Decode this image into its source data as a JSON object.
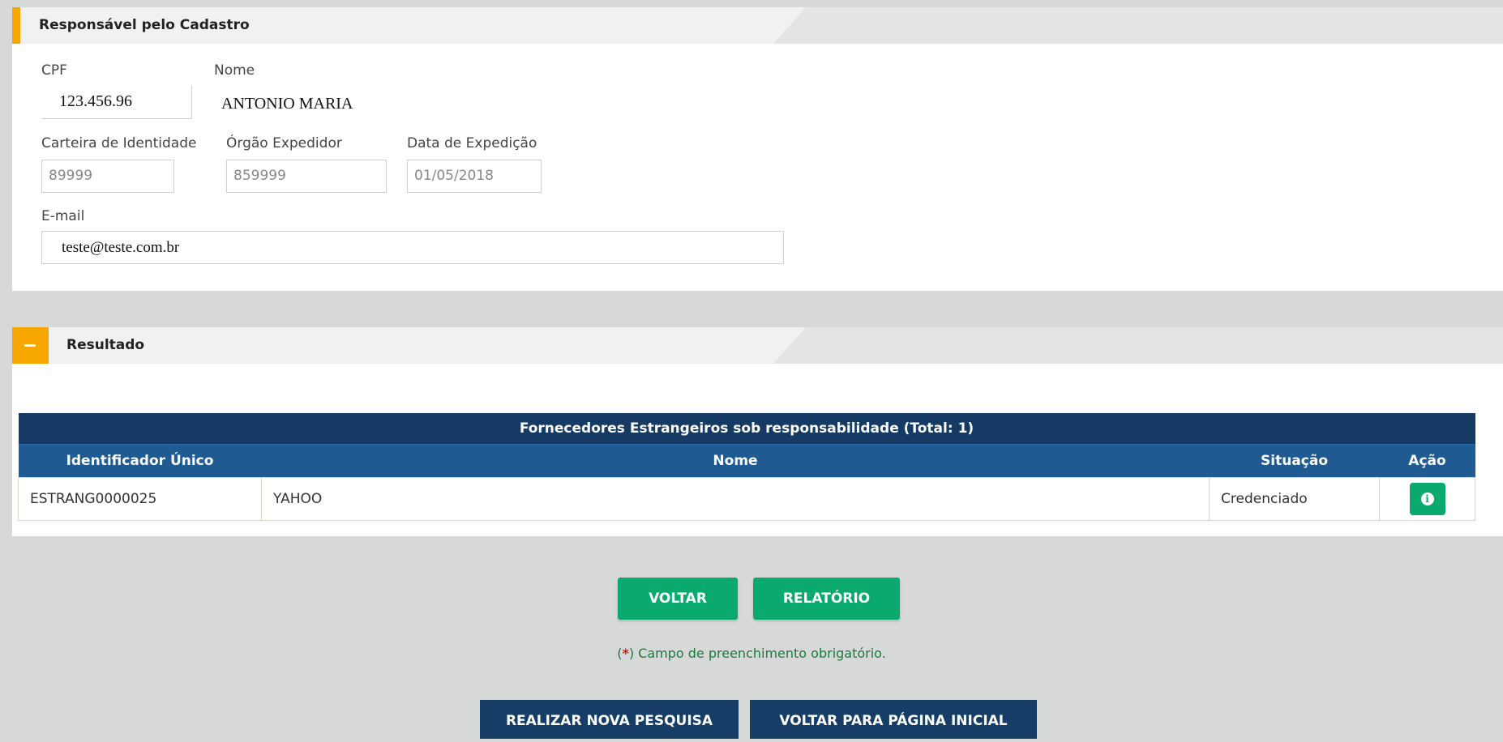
{
  "responsavel": {
    "title": "Responsável pelo Cadastro",
    "cpf_label": "CPF",
    "cpf_value": "123.456.96",
    "nome_label": "Nome",
    "nome_value": "ANTONIO MARIA",
    "identidade_label": "Carteira de Identidade",
    "identidade_value": "89999",
    "orgao_label": "Órgão Expedidor",
    "orgao_value": "859999",
    "data_label": "Data de Expedição",
    "data_value": "01/05/2018",
    "email_label": "E-mail",
    "email_value": "teste@teste.com.br"
  },
  "resultado": {
    "toggle_icon": "minus-icon",
    "title": "Resultado",
    "table": {
      "caption": "Fornecedores Estrangeiros sob responsabilidade (Total: 1)",
      "columns": [
        "Identificador Único",
        "Nome",
        "Situação",
        "Ação"
      ],
      "rows": [
        {
          "id": "ESTRANG0000025",
          "nome": "YAHOO",
          "situacao": "Credenciado",
          "acao_icon": "info-icon"
        }
      ]
    }
  },
  "actions": {
    "voltar": "VOLTAR",
    "relatorio": "RELATÓRIO",
    "note_open": "(",
    "note_star": "*",
    "note_text": ") Campo de preenchimento obrigatório.",
    "nova_pesquisa": "REALIZAR NOVA PESQUISA",
    "pagina_inicial": "VOLTAR PARA PÁGINA INICIAL"
  },
  "colors": {
    "accent": "#f7a600",
    "green": "#0aaa6e",
    "navy": "#163d66",
    "table_header": "#1f5a93"
  }
}
